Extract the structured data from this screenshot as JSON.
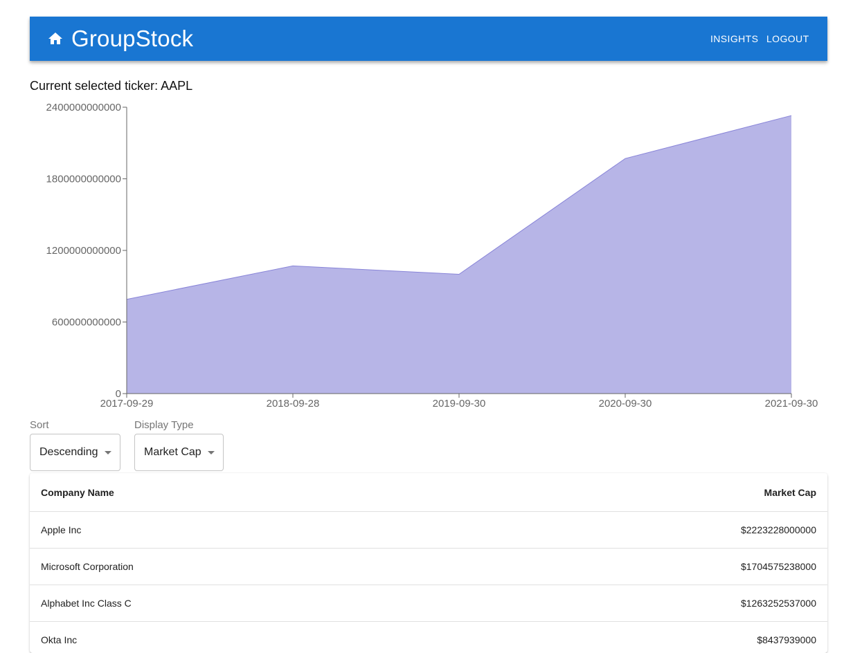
{
  "appbar": {
    "brand": "GroupStock",
    "nav": [
      "INSIGHTS",
      "LOGOUT"
    ],
    "color": "#1976d2"
  },
  "ticker_line": "Current selected ticker: AAPL",
  "chart_data": {
    "type": "area",
    "x": [
      "2017-09-29",
      "2018-09-28",
      "2019-09-30",
      "2020-09-30",
      "2021-09-30"
    ],
    "series": [
      {
        "values": [
          790000000000,
          1070000000000,
          1000000000000,
          1970000000000,
          2330000000000
        ]
      }
    ],
    "yticks": [
      "0",
      "600000000000",
      "1200000000000",
      "1800000000000",
      "2400000000000"
    ],
    "ylim": [
      0,
      2400000000000
    ],
    "fill": "#b7b5e7",
    "stroke": "#8884d8",
    "grid": false
  },
  "controls": {
    "sort": {
      "label": "Sort",
      "value": "Descending"
    },
    "display_type": {
      "label": "Display Type",
      "value": "Market Cap"
    }
  },
  "table": {
    "headers": [
      "Company Name",
      "Market Cap"
    ],
    "rows": [
      [
        "Apple Inc",
        "$2223228000000"
      ],
      [
        "Microsoft Corporation",
        "$1704575238000"
      ],
      [
        "Alphabet Inc Class C",
        "$1263252537000"
      ],
      [
        "Okta Inc",
        "$8437939000"
      ]
    ]
  }
}
